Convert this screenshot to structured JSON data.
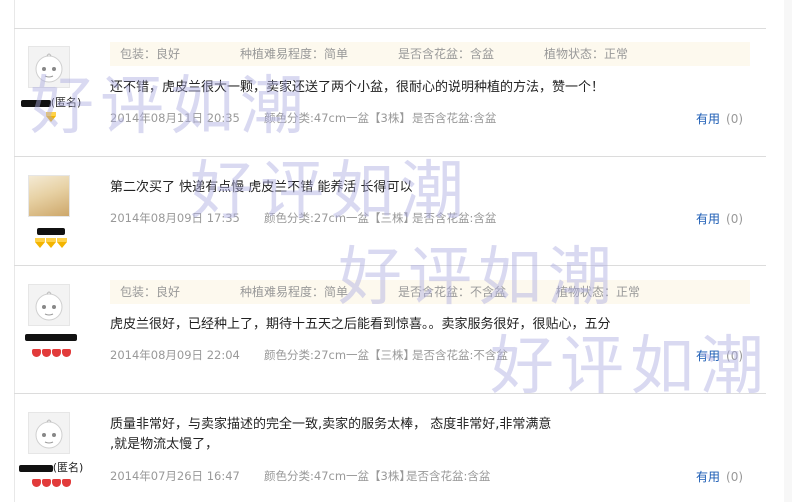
{
  "reviews": [
    {
      "username_suffix": "(匿名)",
      "avatar": "default-avatar-icon",
      "badge": "gold-gem",
      "attributes": [
        "包装：良好",
        "种植难易程度：简单",
        "是否含花盆：含盆",
        "植物状态：正常"
      ],
      "content": "还不错，虎皮兰很大一颗，卖家还送了两个小盆，很耐心的说明种植的方法，赞一个！",
      "date": "2014年08月11日 20:35",
      "spec": "颜色分类:47cm一盆【3株】",
      "pot": "是否含花盆:含盆",
      "useful_label": "有用",
      "useful_count": "(0)"
    },
    {
      "username_suffix": "",
      "avatar": "photo-avatar",
      "badge": "gold-gem-3",
      "attributes": [],
      "content": "第二次买了 快递有点慢 虎皮兰不错 能养活 长得可以",
      "date": "2014年08月09日 17:35",
      "spec": "颜色分类:27cm一盆【三株】",
      "pot": "是否含花盆:含盆",
      "useful_label": "有用",
      "useful_count": "(0)"
    },
    {
      "username_suffix": "",
      "avatar": "default-avatar-icon",
      "badge": "red-heart-4",
      "attributes": [
        "包装：良好",
        "种植难易程度：简单",
        "是否含花盆：不含盆",
        "植物状态：正常"
      ],
      "content": "虎皮兰很好，已经种上了，期待十五天之后能看到惊喜。。卖家服务很好，很贴心，五分",
      "date": "2014年08月09日 22:04",
      "spec": "颜色分类:27cm一盆【三株】",
      "pot": "是否含花盆:不含盆",
      "useful_label": "有用",
      "useful_count": "(0)"
    },
    {
      "username_suffix": "(匿名)",
      "avatar": "default-avatar-icon",
      "badge": "red-heart-4",
      "attributes": [],
      "content_line1": "质量非常好，与卖家描述的完全一致,卖家的服务太棒， 态度非常好,非常满意",
      "content_line2": ",就是物流太慢了，",
      "date": "2014年07月26日 16:47",
      "spec": "颜色分类:47cm一盆【3株】",
      "pot": "是否含花盆:含盆",
      "useful_label": "有用",
      "useful_count": "(0)"
    }
  ],
  "watermark": "好评如潮"
}
